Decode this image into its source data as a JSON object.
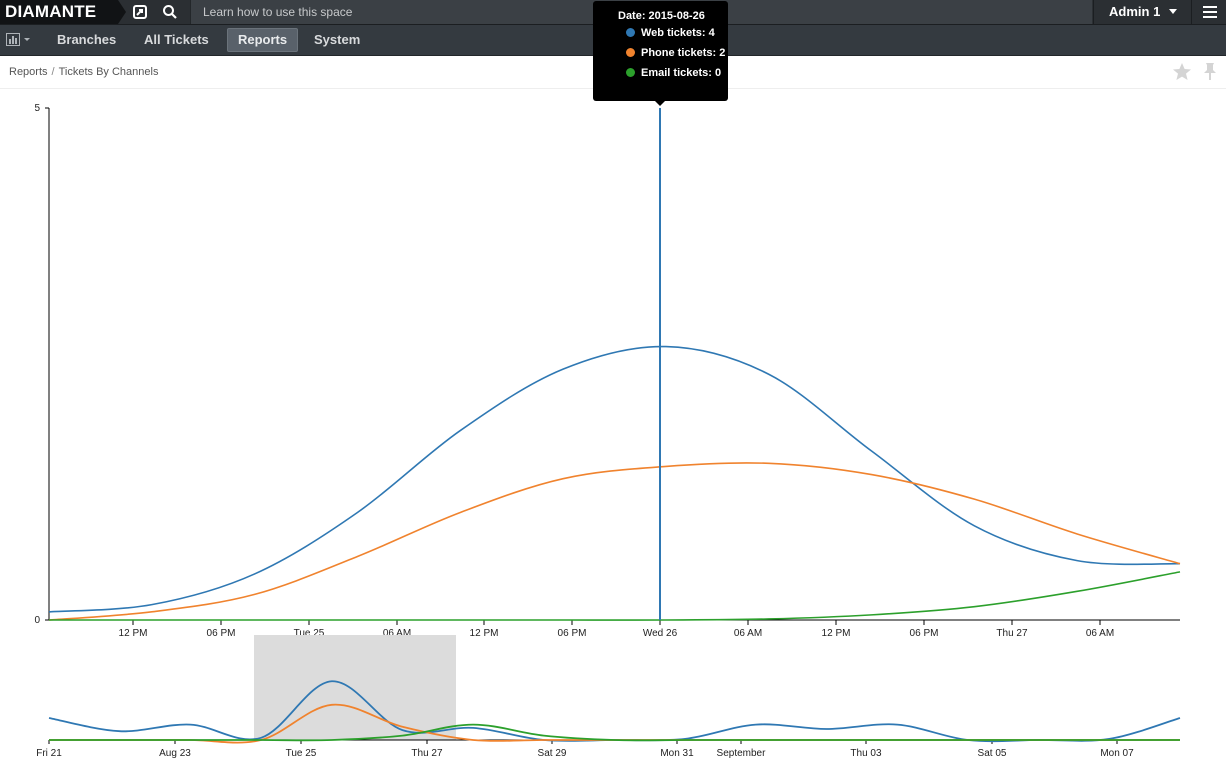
{
  "topbar": {
    "brand": "DIAMANTE",
    "search_placeholder": "Learn how to use this space",
    "user_name": "Admin 1"
  },
  "nav": {
    "tabs": [
      {
        "label": "Branches"
      },
      {
        "label": "All Tickets"
      },
      {
        "label": "Reports",
        "active": true
      },
      {
        "label": "System"
      }
    ]
  },
  "breadcrumb": {
    "root": "Reports",
    "separator": "/",
    "current": "Tickets By Channels"
  },
  "tooltip": {
    "date": "Date: 2015-08-26",
    "rows": [
      {
        "label": "Web tickets: 4",
        "color": "#2f78b3"
      },
      {
        "label": "Phone tickets: 2",
        "color": "#f0832e"
      },
      {
        "label": "Email tickets: 0",
        "color": "#2ca02c"
      }
    ]
  },
  "chart_data": [
    {
      "type": "line",
      "y_ticks": [
        "5",
        "0"
      ],
      "ylim": [
        0,
        5
      ],
      "x_ticks": [
        "12 PM",
        "06 PM",
        "Tue 25",
        "06 AM",
        "12 PM",
        "06 PM",
        "Wed 26",
        "06 AM",
        "12 PM",
        "06 PM",
        "Thu 27",
        "06 AM"
      ],
      "hover_date": "2015-08-26",
      "series": [
        {
          "name": "Web tickets",
          "color": "#2f78b3",
          "values": [
            0.08,
            0.15,
            0.45,
            1.05,
            1.85,
            2.45,
            2.67,
            2.4,
            1.65,
            0.92,
            0.58,
            0.55
          ]
        },
        {
          "name": "Phone tickets",
          "color": "#f0832e",
          "values": [
            0.0,
            0.08,
            0.25,
            0.62,
            1.05,
            1.38,
            1.5,
            1.53,
            1.42,
            1.18,
            0.84,
            0.55
          ]
        },
        {
          "name": "Email tickets",
          "color": "#2ca02c",
          "values": [
            0.0,
            0.0,
            0.0,
            0.0,
            0.0,
            0.0,
            0.0,
            0.01,
            0.05,
            0.13,
            0.28,
            0.47
          ]
        }
      ]
    },
    {
      "type": "line",
      "x_ticks": [
        "Fri 21",
        "Aug 23",
        "Tue 25",
        "Thu 27",
        "Sat 29",
        "Mon 31",
        "September",
        "Thu 03",
        "Sat 05",
        "Mon 07"
      ],
      "brush_range": [
        "Tue 25",
        "Thu 27"
      ],
      "series": [
        {
          "name": "Web tickets",
          "color": "#2f78b3",
          "values": [
            1.0,
            0.4,
            0.7,
            0.1,
            2.67,
            0.45,
            0.55,
            0.0,
            0.0,
            0.05,
            0.7,
            0.5,
            0.7,
            0.0,
            0.0,
            0.05,
            1.0
          ]
        },
        {
          "name": "Phone tickets",
          "color": "#f0832e",
          "values": [
            0.0,
            0.0,
            0.0,
            0.0,
            1.6,
            0.6,
            0.0,
            0.0,
            0.0,
            0.0,
            0.0,
            0.0,
            0.0,
            0.0,
            0.0,
            0.0,
            0.0
          ]
        },
        {
          "name": "Email tickets",
          "color": "#2ca02c",
          "values": [
            0.0,
            0.0,
            0.0,
            0.0,
            0.0,
            0.2,
            0.7,
            0.2,
            0.0,
            0.0,
            0.0,
            0.0,
            0.0,
            0.0,
            0.0,
            0.0,
            0.0
          ]
        }
      ]
    }
  ]
}
